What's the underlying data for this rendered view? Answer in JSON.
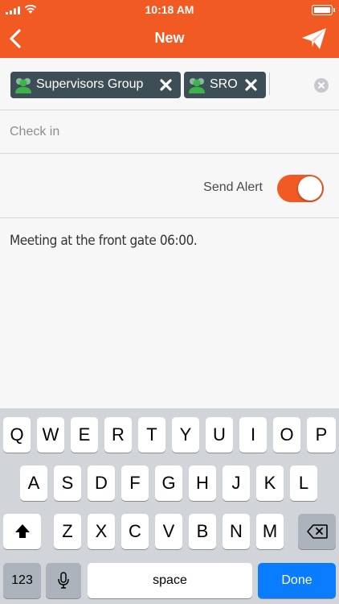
{
  "status_bar": {
    "time": "10:18 AM"
  },
  "nav": {
    "title": "New",
    "back_icon": "chevron-left-icon",
    "send_icon": "paper-plane-icon"
  },
  "recipients": [
    {
      "label": "Supervisors Group"
    },
    {
      "label": "SRO"
    }
  ],
  "subject": {
    "placeholder": "Check in"
  },
  "alert": {
    "label": "Send Alert",
    "enabled": true
  },
  "message": {
    "text": "Meeting at the front gate 06:00."
  },
  "keyboard": {
    "row1": [
      "Q",
      "W",
      "E",
      "R",
      "T",
      "Y",
      "U",
      "I",
      "O",
      "P"
    ],
    "row2": [
      "A",
      "S",
      "D",
      "F",
      "G",
      "H",
      "J",
      "K",
      "L"
    ],
    "row3": [
      "Z",
      "X",
      "C",
      "V",
      "B",
      "N",
      "M"
    ],
    "numbers_key": "123",
    "space_key": "space",
    "done_key": "Done"
  },
  "colors": {
    "accent": "#f15a22",
    "chip": "#3e4e57",
    "done": "#0a7cff"
  }
}
